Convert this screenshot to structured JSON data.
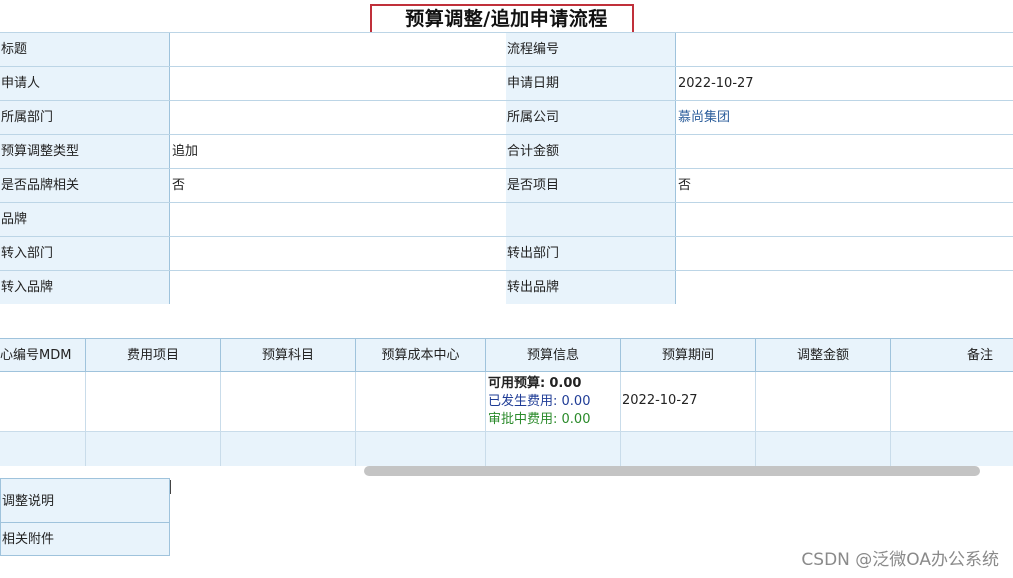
{
  "title": "预算调整/追加申请流程",
  "form": {
    "rows": [
      {
        "l1": "标题",
        "v1": "",
        "l2": "流程编号",
        "v2": ""
      },
      {
        "l1": "申请人",
        "v1": "",
        "l2": "申请日期",
        "v2": "2022-10-27"
      },
      {
        "l1": "所属部门",
        "v1": "",
        "l2": "所属公司",
        "v2": "慕尚集团"
      },
      {
        "l1": "预算调整类型",
        "v1": "追加",
        "l2": "合计金额",
        "v2": ""
      },
      {
        "l1": "是否品牌相关",
        "v1": "否",
        "l2": "是否项目",
        "v2": "否"
      },
      {
        "l1": "品牌",
        "v1": "",
        "l2": "",
        "v2": ""
      },
      {
        "l1": "转入部门",
        "v1": "",
        "l2": "转出部门",
        "v2": ""
      },
      {
        "l1": "转入品牌",
        "v1": "",
        "l2": "转出品牌",
        "v2": ""
      }
    ]
  },
  "detail": {
    "headers": [
      "心编号MDM",
      "费用项目",
      "预算科目",
      "预算成本中心",
      "预算信息",
      "预算期间",
      "调整金额",
      "备注"
    ],
    "row": {
      "available_label": "可用预算:",
      "available_value": "0.00",
      "incurred_label": "已发生费用:",
      "incurred_value": "0.00",
      "pending_label": "审批中费用:",
      "pending_value": "0.00",
      "period": "2022-10-27"
    }
  },
  "bottom": {
    "adjust_label": "调整说明",
    "attach_label": "相关附件"
  },
  "watermark": "CSDN @泛微OA办公系统"
}
